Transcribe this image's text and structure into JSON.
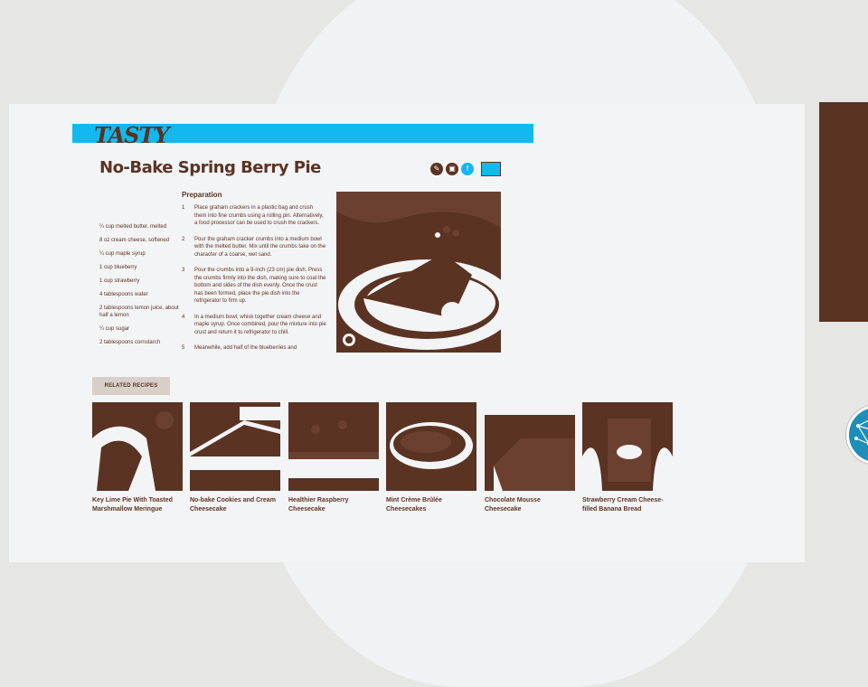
{
  "brand": {
    "logo_text": "TASTY"
  },
  "recipe": {
    "title": "No-Bake Spring Berry Pie",
    "ingredients": [
      "¼ cup melted butter, melted",
      "8 oz cream cheese, softened",
      "¼ cup maple syrup",
      "1 cup blueberry",
      "1 cup strawberry",
      "4 tablespoons water",
      "2 tablespoons lemon juice, about half a lemon",
      "¼ cup sugar",
      "2 tablespoons cornstarch"
    ],
    "preparation_title": "Preparation",
    "steps": [
      {
        "num": "1",
        "text": "Place graham crackers in a plastic bag and crush them into fine crumbs using a rolling pin. Alternatively, a food processor can be used to crush the crackers."
      },
      {
        "num": "2",
        "text": "Pour the graham cracker crumbs into a medium bowl with the melted butter. Mix until the crumbs take on the character of a coarse, wet sand."
      },
      {
        "num": "3",
        "text": "Pour the crumbs into a 9-inch (23 cm) pie dish. Press the crumbs firmly into the dish, making sure to coat the bottom and sides of the dish evenly. Once the crust has been formed, place the pie dish into the refrigerator to firm up."
      },
      {
        "num": "4",
        "text": "In a medium bowl, whisk together cream cheese and maple syrup. Once combined, pour the mixture into pie crust and return it to refrigerator to chill."
      },
      {
        "num": "5",
        "text": "Meanwhile, add half of the blueberries and"
      }
    ],
    "share_buttons": [
      "share-icon",
      "pinterest-icon",
      "facebook-icon",
      "email-icon"
    ]
  },
  "related": {
    "label": "RELATED RECIPES",
    "items": [
      {
        "title": "Key Lime Pie With Toasted Marshmallow Meringue"
      },
      {
        "title": "No-bake Cookies and Cream Cheesecake"
      },
      {
        "title": "Healthier Raspberry Cheesecake"
      },
      {
        "title": "Mint Crème Brûlée Cheesecakes"
      },
      {
        "title": "Chocolate Mousse Cheesecake"
      },
      {
        "title": "Strawberry Cream Cheese-filled Banana Bread"
      }
    ]
  },
  "colors": {
    "brand_brown": "#5b3323",
    "header_blue": "#12b8ee",
    "panel": "#f3f4f6"
  }
}
